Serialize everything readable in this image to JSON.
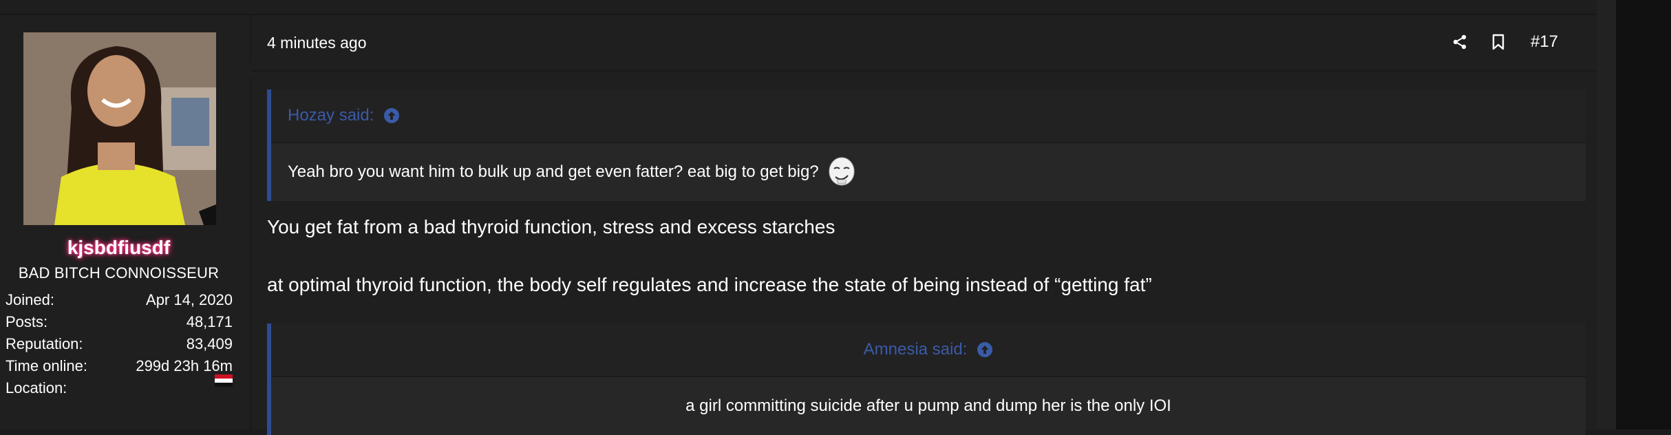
{
  "user": {
    "username": "kjsbdfiusdf",
    "title": "BAD BITCH CONNOISSEUR",
    "stats": [
      {
        "label": "Joined:",
        "value": "Apr 14, 2020"
      },
      {
        "label": "Posts:",
        "value": "48,171"
      },
      {
        "label": "Reputation:",
        "value": "83,409"
      },
      {
        "label": "Time online:",
        "value": "299d 23h 16m"
      },
      {
        "label": "Location:",
        "value": ""
      }
    ],
    "location_flag": "iraq-flag-icon"
  },
  "post": {
    "timestamp": "4 minutes ago",
    "post_number": "#17",
    "actions": [
      "share-icon",
      "bookmark-icon"
    ],
    "quote1": {
      "author": "Hozay said:",
      "text": "Yeah bro you want him to bulk up and get even fatter? eat big to get big?",
      "emoji": "smug-face-emoji"
    },
    "message_lines": [
      "You get fat from a bad thyroid function, stress and excess starches",
      "at optimal thyroid function, the body self regulates and increase the state of being instead of “getting fat”"
    ],
    "quote2": {
      "author": "Amnesia said:",
      "text": "a girl committing suicide after u pump and dump her is the only IOI"
    }
  },
  "colors": {
    "quote_accent": "#2f4c92",
    "quote_author": "#3a5ba8",
    "username_glow": "#ff3a8a"
  }
}
